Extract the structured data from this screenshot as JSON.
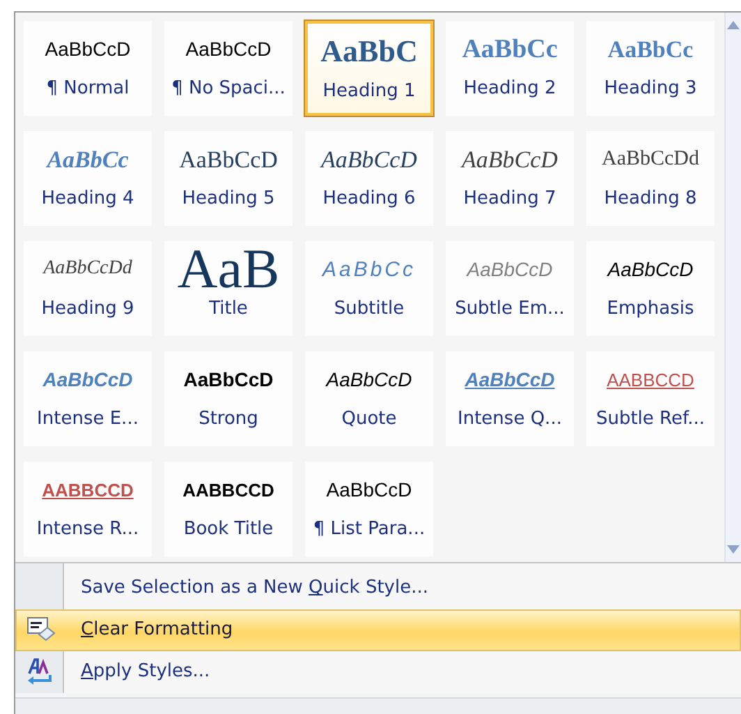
{
  "styles": [
    {
      "sample": "AaBbCcD",
      "label": "¶ Normal",
      "kind": "normal",
      "selected": false
    },
    {
      "sample": "AaBbCcD",
      "label": "¶ No Spaci...",
      "kind": "normal",
      "selected": false
    },
    {
      "sample": "AaBbC",
      "label": "Heading 1",
      "kind": "heading1",
      "selected": true
    },
    {
      "sample": "AaBbCc",
      "label": "Heading 2",
      "kind": "heading2",
      "selected": false
    },
    {
      "sample": "AaBbCc",
      "label": "Heading 3",
      "kind": "heading3",
      "selected": false
    },
    {
      "sample": "AaBbCc",
      "label": "Heading 4",
      "kind": "heading4",
      "selected": false
    },
    {
      "sample": "AaBbCcD",
      "label": "Heading 5",
      "kind": "heading5",
      "selected": false
    },
    {
      "sample": "AaBbCcD",
      "label": "Heading 6",
      "kind": "heading6",
      "selected": false
    },
    {
      "sample": "AaBbCcD",
      "label": "Heading 7",
      "kind": "heading7",
      "selected": false
    },
    {
      "sample": "AaBbCcDd",
      "label": "Heading 8",
      "kind": "heading8",
      "selected": false
    },
    {
      "sample": "AaBbCcDd",
      "label": "Heading 9",
      "kind": "heading9",
      "selected": false
    },
    {
      "sample": "AaB",
      "label": "Title",
      "kind": "title",
      "selected": false
    },
    {
      "sample": "AaBbCc",
      "label": "Subtitle",
      "kind": "subtitle",
      "selected": false
    },
    {
      "sample": "AaBbCcD",
      "label": "Subtle Em...",
      "kind": "subtle",
      "selected": false
    },
    {
      "sample": "AaBbCcD",
      "label": "Emphasis",
      "kind": "emphasis",
      "selected": false
    },
    {
      "sample": "AaBbCcD",
      "label": "Intense E...",
      "kind": "intense",
      "selected": false
    },
    {
      "sample": "AaBbCcD",
      "label": "Strong",
      "kind": "strong",
      "selected": false
    },
    {
      "sample": "AaBbCcD",
      "label": "Quote",
      "kind": "quote",
      "selected": false
    },
    {
      "sample": "AaBbCcD",
      "label": "Intense Q...",
      "kind": "intensequote",
      "selected": false
    },
    {
      "sample": "AABBCCD",
      "label": "Subtle Ref...",
      "kind": "subtleref",
      "selected": false
    },
    {
      "sample": "AABBCCD",
      "label": "Intense R...",
      "kind": "intenseref",
      "selected": false
    },
    {
      "sample": "AABBCCD",
      "label": "Book Title",
      "kind": "booktitle",
      "selected": false
    },
    {
      "sample": "AaBbCcD",
      "label": "¶ List Para...",
      "kind": "normal",
      "selected": false
    }
  ],
  "menu": [
    {
      "kind": "plain",
      "text_before": "Save Selection as a New ",
      "accelerator": "Q",
      "text_after": "uick Style...",
      "selected": false
    },
    {
      "kind": "clear",
      "accelerator": "C",
      "text_after": "lear Formatting",
      "selected": true
    },
    {
      "kind": "apply",
      "accelerator": "A",
      "text_after": "pply Styles...",
      "selected": false
    }
  ]
}
